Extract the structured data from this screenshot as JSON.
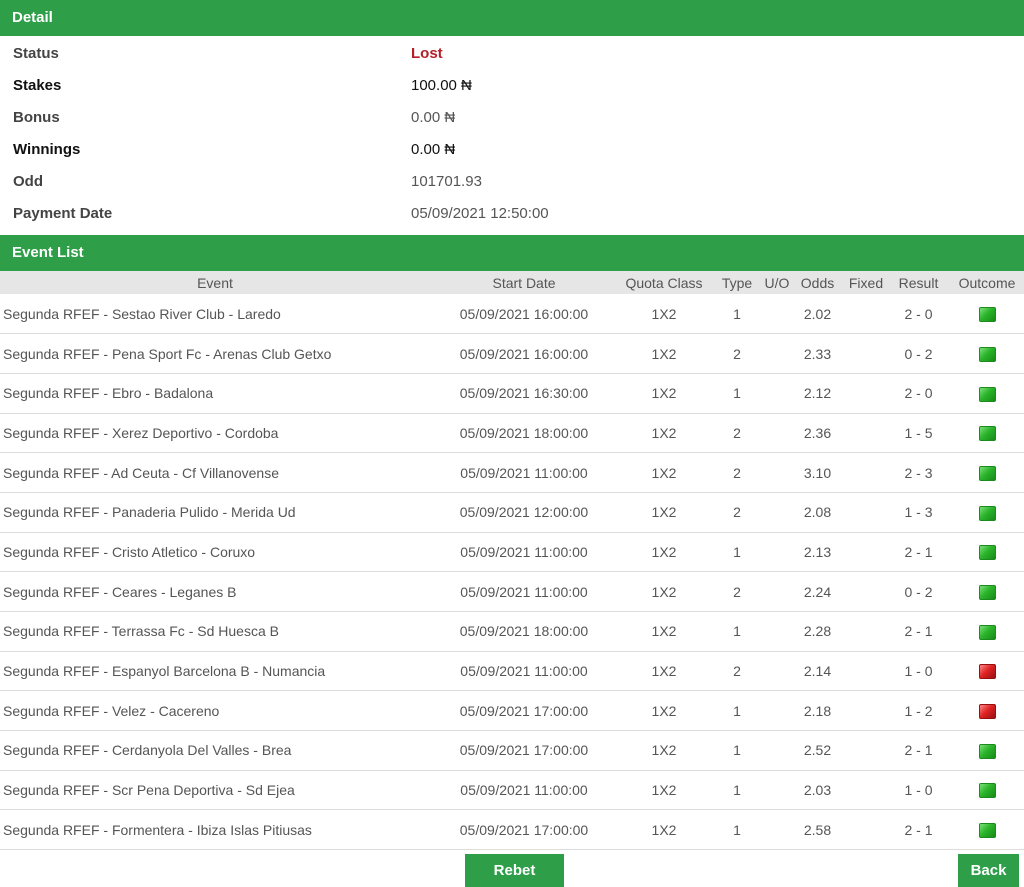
{
  "detail": {
    "title": "Detail",
    "rows": [
      {
        "label": "Status",
        "value": "Lost"
      },
      {
        "label": "Stakes",
        "value": "100.00 ₦"
      },
      {
        "label": "Bonus",
        "value": "0.00 ₦"
      },
      {
        "label": "Winnings",
        "value": "0.00 ₦"
      },
      {
        "label": "Odd",
        "value": "101701.93"
      },
      {
        "label": "Payment Date",
        "value": "05/09/2021 12:50:00"
      }
    ]
  },
  "event_list": {
    "title": "Event List",
    "columns": [
      "Event",
      "Start Date",
      "Quota Class",
      "Type",
      "U/O",
      "Odds",
      "Fixed",
      "Result",
      "Outcome"
    ],
    "rows": [
      {
        "event": "Segunda RFEF - Sestao River Club - Laredo",
        "start": "05/09/2021 16:00:00",
        "quota": "1X2",
        "type": "1",
        "uo": "",
        "odds": "2.02",
        "fixed": "",
        "result": "2 - 0",
        "outcome": "win"
      },
      {
        "event": "Segunda RFEF - Pena Sport Fc - Arenas Club Getxo",
        "start": "05/09/2021 16:00:00",
        "quota": "1X2",
        "type": "2",
        "uo": "",
        "odds": "2.33",
        "fixed": "",
        "result": "0 - 2",
        "outcome": "win"
      },
      {
        "event": "Segunda RFEF - Ebro - Badalona",
        "start": "05/09/2021 16:30:00",
        "quota": "1X2",
        "type": "1",
        "uo": "",
        "odds": "2.12",
        "fixed": "",
        "result": "2 - 0",
        "outcome": "win"
      },
      {
        "event": "Segunda RFEF - Xerez Deportivo - Cordoba",
        "start": "05/09/2021 18:00:00",
        "quota": "1X2",
        "type": "2",
        "uo": "",
        "odds": "2.36",
        "fixed": "",
        "result": "1 - 5",
        "outcome": "win"
      },
      {
        "event": "Segunda RFEF - Ad Ceuta - Cf Villanovense",
        "start": "05/09/2021 11:00:00",
        "quota": "1X2",
        "type": "2",
        "uo": "",
        "odds": "3.10",
        "fixed": "",
        "result": "2 - 3",
        "outcome": "win"
      },
      {
        "event": "Segunda RFEF - Panaderia Pulido - Merida Ud",
        "start": "05/09/2021 12:00:00",
        "quota": "1X2",
        "type": "2",
        "uo": "",
        "odds": "2.08",
        "fixed": "",
        "result": "1 - 3",
        "outcome": "win"
      },
      {
        "event": "Segunda RFEF - Cristo Atletico - Coruxo",
        "start": "05/09/2021 11:00:00",
        "quota": "1X2",
        "type": "1",
        "uo": "",
        "odds": "2.13",
        "fixed": "",
        "result": "2 - 1",
        "outcome": "win"
      },
      {
        "event": "Segunda RFEF - Ceares - Leganes B",
        "start": "05/09/2021 11:00:00",
        "quota": "1X2",
        "type": "2",
        "uo": "",
        "odds": "2.24",
        "fixed": "",
        "result": "0 - 2",
        "outcome": "win"
      },
      {
        "event": "Segunda RFEF - Terrassa Fc - Sd Huesca B",
        "start": "05/09/2021 18:00:00",
        "quota": "1X2",
        "type": "1",
        "uo": "",
        "odds": "2.28",
        "fixed": "",
        "result": "2 - 1",
        "outcome": "win"
      },
      {
        "event": "Segunda RFEF - Espanyol Barcelona B - Numancia",
        "start": "05/09/2021 11:00:00",
        "quota": "1X2",
        "type": "2",
        "uo": "",
        "odds": "2.14",
        "fixed": "",
        "result": "1 - 0",
        "outcome": "loss"
      },
      {
        "event": "Segunda RFEF - Velez - Cacereno",
        "start": "05/09/2021 17:00:00",
        "quota": "1X2",
        "type": "1",
        "uo": "",
        "odds": "2.18",
        "fixed": "",
        "result": "1 - 2",
        "outcome": "loss"
      },
      {
        "event": "Segunda RFEF - Cerdanyola Del Valles - Brea",
        "start": "05/09/2021 17:00:00",
        "quota": "1X2",
        "type": "1",
        "uo": "",
        "odds": "2.52",
        "fixed": "",
        "result": "2 - 1",
        "outcome": "win"
      },
      {
        "event": "Segunda RFEF - Scr Pena Deportiva - Sd Ejea",
        "start": "05/09/2021 11:00:00",
        "quota": "1X2",
        "type": "1",
        "uo": "",
        "odds": "2.03",
        "fixed": "",
        "result": "1 - 0",
        "outcome": "win"
      },
      {
        "event": "Segunda RFEF - Formentera - Ibiza Islas Pitiusas",
        "start": "05/09/2021 17:00:00",
        "quota": "1X2",
        "type": "1",
        "uo": "",
        "odds": "2.58",
        "fixed": "",
        "result": "2 - 1",
        "outcome": "win"
      }
    ]
  },
  "buttons": {
    "rebet": "Rebet",
    "back": "Back"
  },
  "colors": {
    "header_green": "#2e9e48",
    "lost_red": "#b3202a",
    "outcome_win": "#2bb52b",
    "outcome_loss": "#e02424"
  }
}
